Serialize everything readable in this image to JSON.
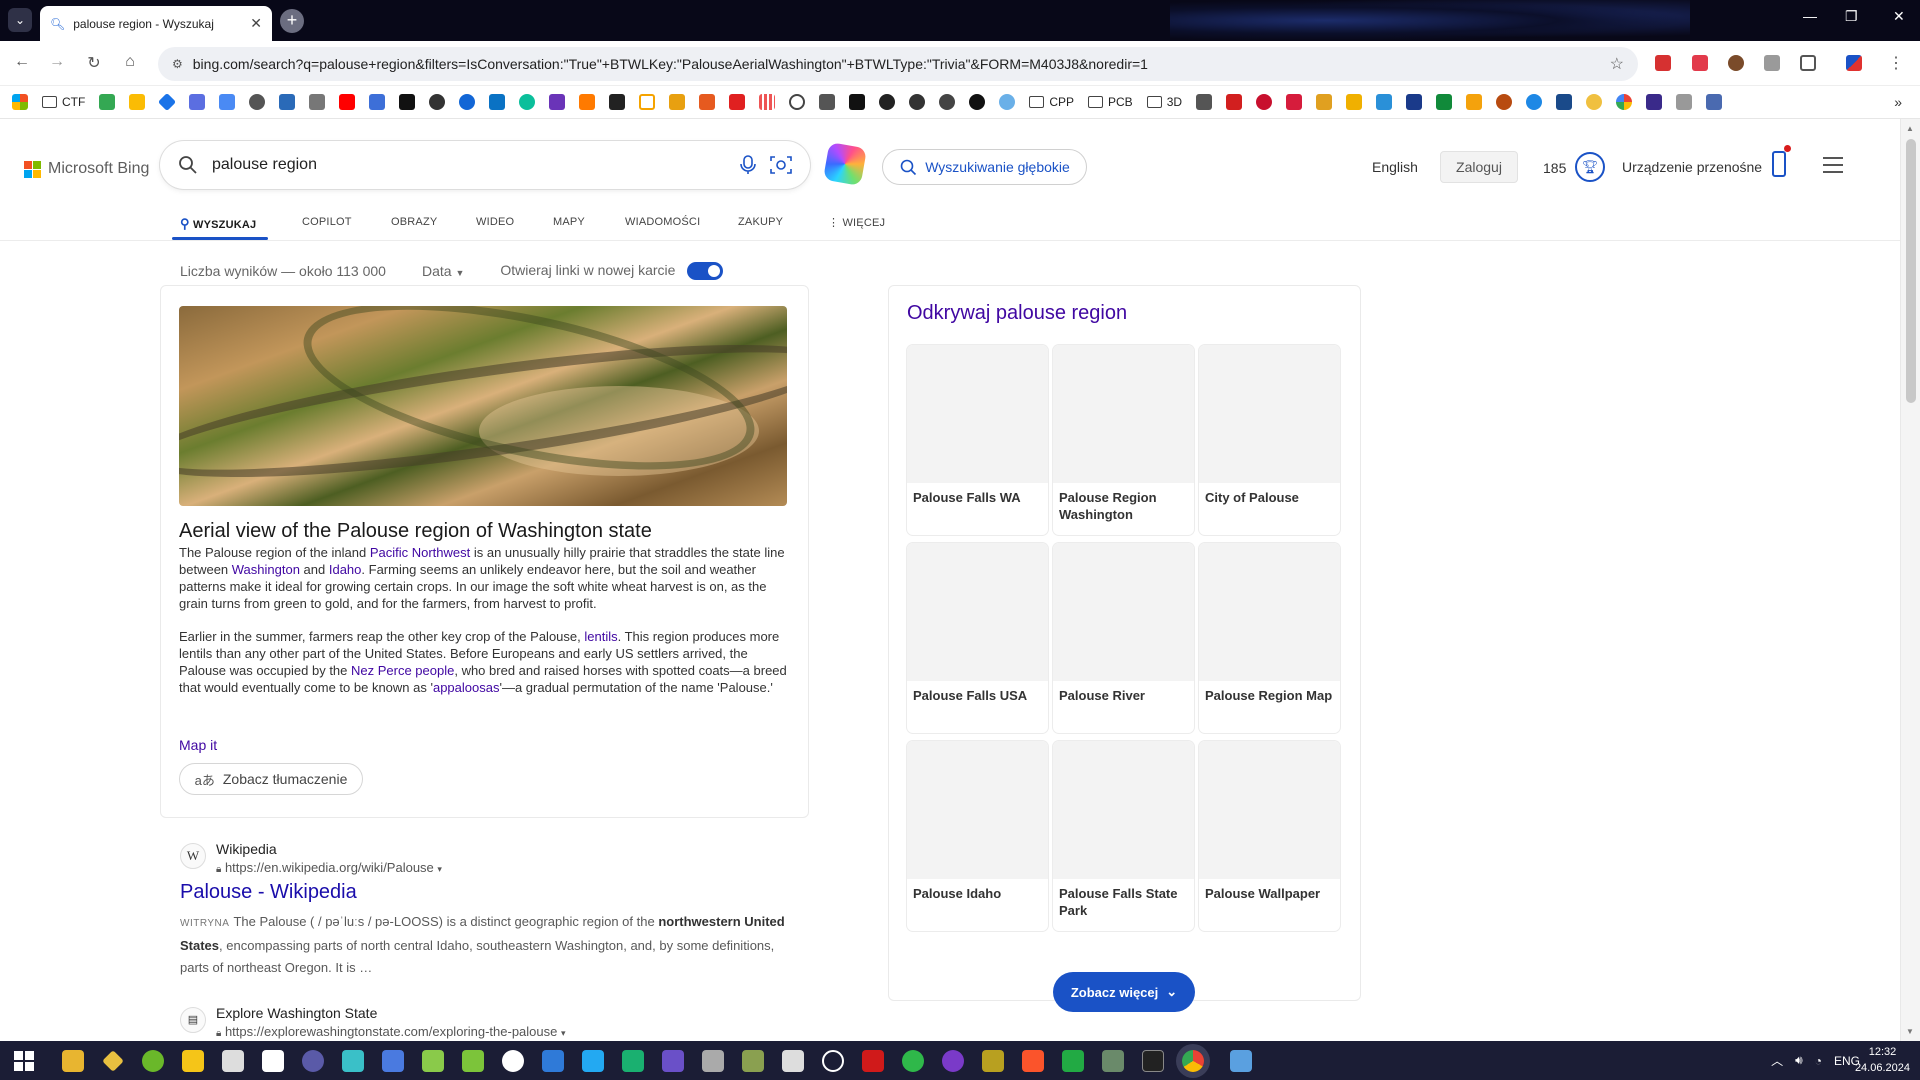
{
  "browser": {
    "tab_title": "palouse region - Wyszukaj",
    "url": "bing.com/search?q=palouse+region&filters=IsConversation:\"True\"+BTWLKey:\"PalouseAerialWashington\"+BTWLType:\"Trivia\"&FORM=M403J8&noredir=1",
    "bookmark_folders": [
      "CTF",
      "CPP",
      "PCB",
      "3D"
    ]
  },
  "header": {
    "logo_text": "Microsoft Bing",
    "query": "palouse region",
    "deep_search_label": "Wyszukiwanie głębokie",
    "language": "English",
    "login_label": "Zaloguj",
    "points": "185",
    "device_label": "Urządzenie przenośne"
  },
  "tabs": [
    "WYSZUKAJ",
    "COPILOT",
    "OBRAZY",
    "WIDEO",
    "MAPY",
    "WIADOMOŚCI",
    "ZAKUPY",
    "WIĘCEJ"
  ],
  "filters": {
    "result_count": "Liczba wyników — około 113 000",
    "date_label": "Data",
    "new_tab_label": "Otwieraj linki w nowej karcie"
  },
  "card": {
    "title": "Aerial view of the Palouse region of Washington state",
    "p1": {
      "t1": "The Palouse region of the inland ",
      "l1": "Pacific Northwest",
      "t2": " is an unusually hilly prairie that straddles the state line between ",
      "l2": "Washington",
      "t3": " and ",
      "l3": "Idaho",
      "t4": ". Farming seems an unlikely endeavor here, but the soil and weather patterns make it ideal for growing certain crops. In our image the soft white wheat harvest is on, as the grain turns from green to gold, and for the farmers, from harvest to profit."
    },
    "p2": {
      "t1": "Earlier in the summer, farmers reap the other key crop of the Palouse, ",
      "l1": "lentils",
      "t2": ". This region produces more lentils than any other part of the United States. Before Europeans and early US settlers arrived, the Palouse was occupied by the ",
      "l2": "Nez Perce people",
      "t3": ", who bred and raised horses with spotted coats—a breed that would eventually come to be known as '",
      "l3": "appaloosas",
      "t4": "'—a gradual permutation of the name 'Palouse.'"
    },
    "map_link": "Map it",
    "translate_label": "Zobacz tłumaczenie"
  },
  "results": [
    {
      "site": "Wikipedia",
      "url": "https://en.wikipedia.org/wiki/Palouse",
      "title": "Palouse - Wikipedia",
      "badge": "WITRYNA",
      "snippet_a": "The Palouse ( / pəˈluːs / pə-LOOSS) is a distinct geographic region of the ",
      "snippet_b1": "northwestern United States",
      "snippet_c": ", encompassing parts of north central Idaho, southeastern Washington, and, by some definitions, parts of northeast Oregon. It is …"
    },
    {
      "site": "Explore Washington State",
      "url": "https://explorewashingtonstate.com/exploring-the-palouse"
    }
  ],
  "explore": {
    "title": "Odkrywaj palouse region",
    "tiles": [
      "Palouse Falls WA",
      "Palouse Region Washington",
      "City of Palouse",
      "Palouse Falls USA",
      "Palouse River",
      "Palouse Region Map",
      "Palouse Idaho",
      "Palouse Falls State Park",
      "Palouse Wallpaper"
    ],
    "more_label": "Zobacz więcej"
  },
  "taskbar": {
    "lang": "ENG",
    "time": "12:32",
    "date": "24.06.2024"
  }
}
